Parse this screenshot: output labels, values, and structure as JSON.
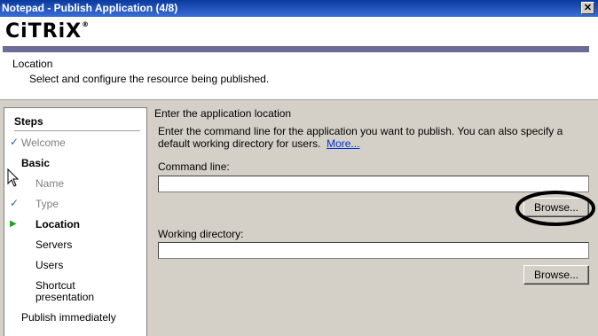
{
  "window": {
    "title": "Notepad - Publish Application (4/8)",
    "close_glyph": "✕"
  },
  "header": {
    "logo": "CiTRiX",
    "logo_mark": "®",
    "section_title": "Location",
    "section_desc": "Select and configure the resource being published."
  },
  "steps": {
    "heading": "Steps",
    "items": [
      {
        "label": "Welcome",
        "state": "done",
        "mark": "✓"
      },
      {
        "label": "Basic",
        "state": "group",
        "mark": ""
      },
      {
        "label": "Name",
        "state": "done",
        "mark": ""
      },
      {
        "label": "Type",
        "state": "done",
        "mark": "✓"
      },
      {
        "label": "Location",
        "state": "current",
        "mark": "▶"
      },
      {
        "label": "Servers",
        "state": "pending",
        "mark": ""
      },
      {
        "label": "Users",
        "state": "pending",
        "mark": ""
      },
      {
        "label": "Shortcut",
        "state": "pending",
        "mark": ""
      },
      {
        "label": "presentation",
        "state": "pending",
        "mark": ""
      },
      {
        "label": "Publish immediately",
        "state": "pending",
        "mark": ""
      }
    ]
  },
  "content": {
    "heading": "Enter the application location",
    "desc": "Enter the command line for the application you want to publish.  You can also specify a default working directory for users.",
    "more_link": "More...",
    "command_line_label": "Command line:",
    "command_line_value": "",
    "working_dir_label": "Working directory:",
    "working_dir_value": "",
    "browse_label": "Browse..."
  },
  "colors": {
    "accent_bar": "#6b6b97",
    "title_bar": "#0b3a9e",
    "link": "#0033cc"
  }
}
